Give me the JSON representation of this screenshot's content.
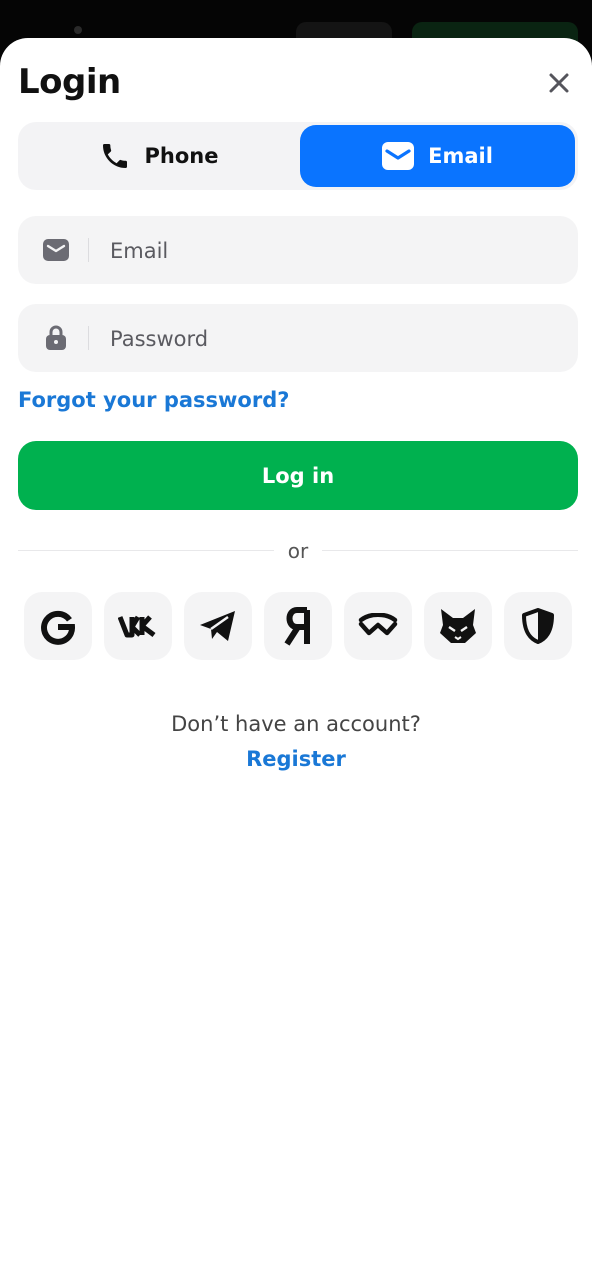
{
  "modal": {
    "title": "Login",
    "close_icon": "close-icon"
  },
  "tabs": [
    {
      "label": "Phone",
      "icon": "phone-icon",
      "active": false
    },
    {
      "label": "Email",
      "icon": "envelope-icon",
      "active": true
    }
  ],
  "form": {
    "email_placeholder": "Email",
    "email_value": "",
    "password_placeholder": "Password",
    "password_value": "",
    "forgot_label": "Forgot your password?",
    "submit_label": "Log in"
  },
  "divider_label": "or",
  "social_logins": [
    {
      "name": "google-icon"
    },
    {
      "name": "vk-icon"
    },
    {
      "name": "telegram-icon"
    },
    {
      "name": "yandex-icon"
    },
    {
      "name": "walletconnect-icon"
    },
    {
      "name": "metamask-fox-icon"
    },
    {
      "name": "shield-icon"
    }
  ],
  "footer": {
    "prompt": "Don’t have an account?",
    "register_label": "Register"
  },
  "colors": {
    "accent_blue": "#0a74ff",
    "link_blue": "#1a78d6",
    "primary_green": "#00b14f",
    "field_bg": "#f4f4f5"
  }
}
